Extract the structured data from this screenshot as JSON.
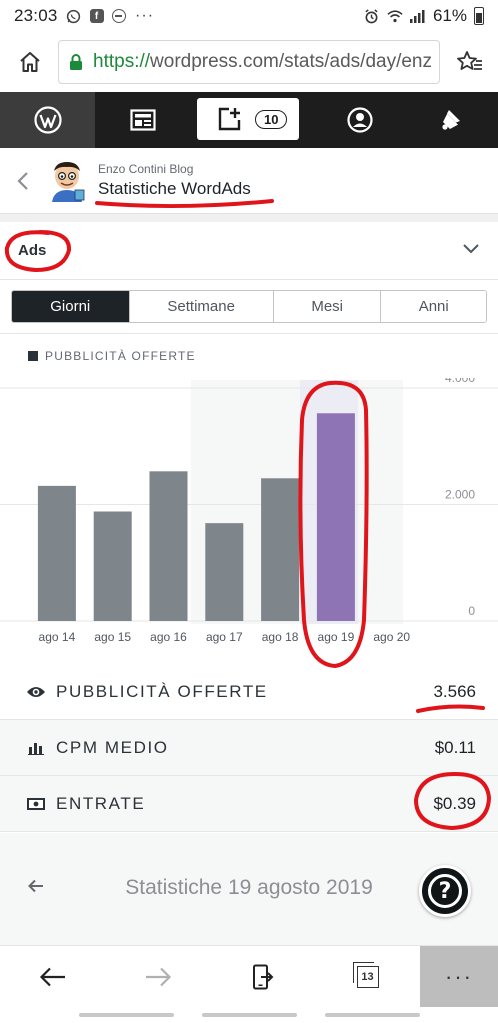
{
  "status_bar": {
    "time": "23:03",
    "battery": "61%",
    "notification_icons": [
      "whatsapp-icon",
      "facebook-icon",
      "dnd-icon",
      "more-notifications-icon"
    ]
  },
  "browser": {
    "url_scheme": "https://",
    "url_rest": "wordpress.com/stats/ads/day/enz",
    "tab_count": "13"
  },
  "masterbar": {
    "write_count": "10"
  },
  "site": {
    "name": "Enzo Contini Blog",
    "title": "Statistiche WordAds"
  },
  "module": {
    "title": "Ads"
  },
  "period_tabs": [
    {
      "label": "Giorni",
      "active": true
    },
    {
      "label": "Settimane",
      "active": false
    },
    {
      "label": "Mesi",
      "active": false
    },
    {
      "label": "Anni",
      "active": false
    }
  ],
  "legend": {
    "label": "PUBBLICITÀ OFFERTE"
  },
  "chart_data": {
    "type": "bar",
    "categories": [
      "ago 14",
      "ago 15",
      "ago 16",
      "ago 17",
      "ago 18",
      "ago 19",
      "ago 20"
    ],
    "values": [
      2320,
      1880,
      2570,
      1680,
      2450,
      3566,
      0
    ],
    "ylim": [
      0,
      4000
    ],
    "yticks": [
      0,
      2000,
      4000
    ],
    "ytick_labels": [
      "0",
      "2.000",
      "4.000"
    ],
    "selected_index": 5,
    "colors": {
      "bar": "#7f868b",
      "selected": "#8e73b5"
    },
    "grid": true
  },
  "summary": [
    {
      "icon": "eye-icon",
      "label": "PUBBLICITÀ OFFERTE",
      "value": "3.566"
    },
    {
      "icon": "bar-chart-icon",
      "label": "CPM MEDIO",
      "value": "$0.11"
    },
    {
      "icon": "money-icon",
      "label": "ENTRATE",
      "value": "$0.39"
    }
  ],
  "navigation": {
    "title": "Statistiche 19 agosto 2019",
    "help_label": "?"
  },
  "colors": {
    "masterbar": "#1d1d1d",
    "active_tab": "#1d2327",
    "annotation": "#e0151b"
  }
}
